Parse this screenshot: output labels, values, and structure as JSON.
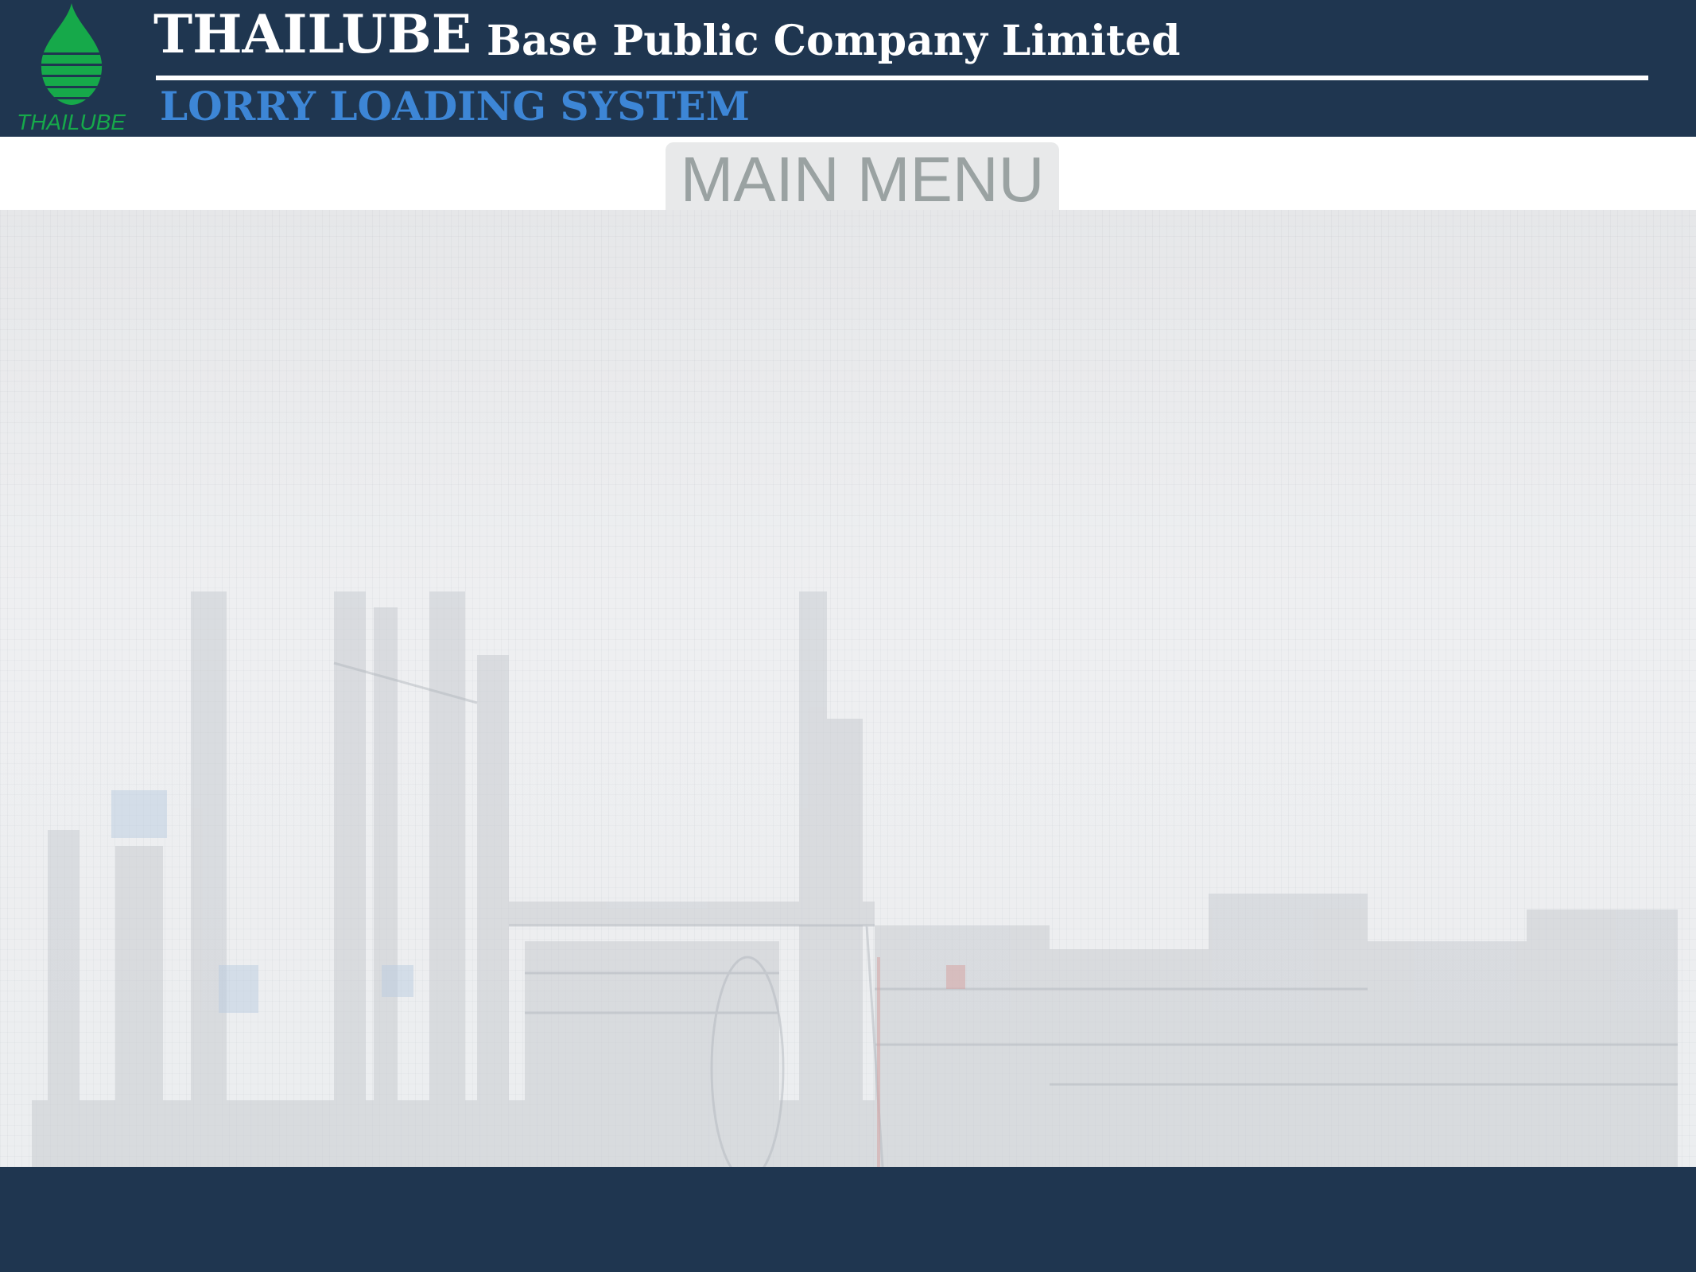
{
  "header": {
    "logo_text": "THAILUBE",
    "brand_name": "THAILUBE",
    "company_suffix": "Base Public Company Limited",
    "system_title": "LORRY LOADING SYSTEM"
  },
  "menu": {
    "active_tab_label": "MAIN MENU"
  },
  "colors": {
    "header_bg": "#1f3650",
    "footer_bg": "#1f3650",
    "logo_green": "#16a94a",
    "system_title_blue": "#3d86d6",
    "menu_tab_bg": "#e8e9ea",
    "menu_tab_text": "#9aa2a2"
  },
  "icons": {
    "logo": "oil-drop-logo-icon",
    "background": "refinery-illustration"
  }
}
